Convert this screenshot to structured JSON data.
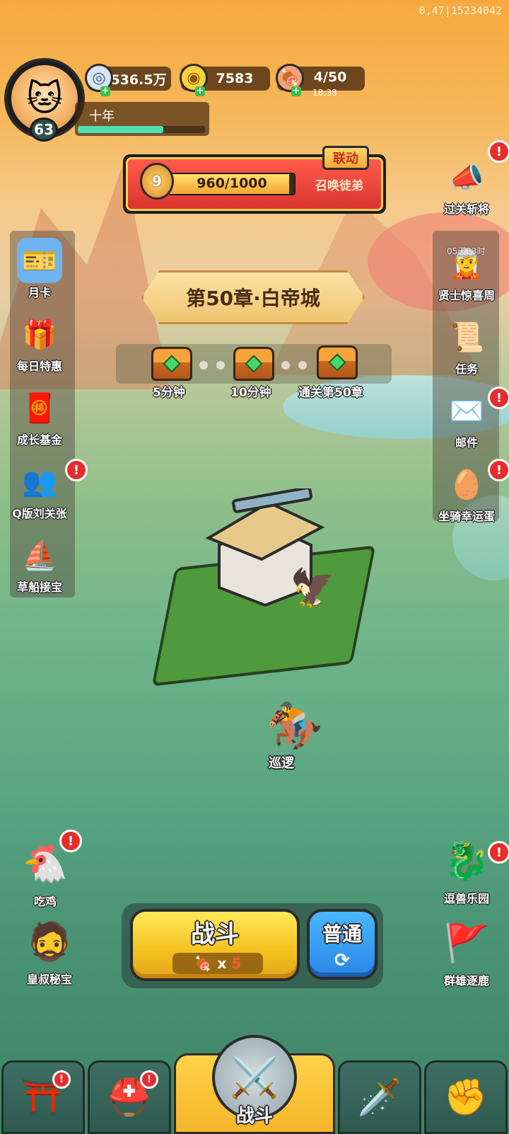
{
  "debug_overlay": "0,47|15234042",
  "player": {
    "level": "63",
    "name": "十年",
    "exp_fraction": 0.67
  },
  "resources": [
    {
      "icon": "silver-coin-icon",
      "value": "536.5万"
    },
    {
      "icon": "gold-ingot-icon",
      "value": "7583"
    },
    {
      "icon": "meat-icon",
      "value": "4/50",
      "timer": "18:38"
    }
  ],
  "banner": {
    "tag": "联动",
    "medal_level": "9",
    "progress_text": "960/1000",
    "progress_fraction": 0.96,
    "action_label": "召唤徒弟"
  },
  "chapter": {
    "title": "第50章·白帝城"
  },
  "rewards": [
    {
      "label": "5分钟"
    },
    {
      "label": "10分钟"
    },
    {
      "label": "通关第50章"
    }
  ],
  "left_menu": [
    {
      "id": "monthly-card",
      "label": "月卡",
      "icon": "welfare-card-icon",
      "alert": false
    },
    {
      "id": "daily-deal",
      "label": "每日特惠",
      "icon": "gift-bag-icon",
      "alert": false
    },
    {
      "id": "growth-fund",
      "label": "成长基金",
      "icon": "money-god-icon",
      "alert": false
    },
    {
      "id": "q-liu-guan-zhang",
      "label": "Q版刘关张",
      "icon": "three-brothers-icon",
      "alert": true
    },
    {
      "id": "straw-boat",
      "label": "草船接宝",
      "icon": "boat-icon",
      "alert": false
    }
  ],
  "right_menu": [
    {
      "id": "stage-general",
      "label": "过关斩将",
      "icon": "megaphone-girl-icon",
      "alert": true
    },
    {
      "id": "sage-week",
      "label": "贤士惊喜周",
      "icon": "sage-icon",
      "alert": false,
      "timer": "05天23时"
    },
    {
      "id": "tasks",
      "label": "任务",
      "icon": "scroll-icon",
      "alert": false
    },
    {
      "id": "mail",
      "label": "邮件",
      "icon": "mail-icon",
      "alert": true
    },
    {
      "id": "mount-egg",
      "label": "坐骑幸运蛋",
      "icon": "panda-egg-icon",
      "alert": true
    }
  ],
  "bottom_left": [
    {
      "id": "chicken",
      "label": "吃鸡",
      "icon": "chicken-warrior-icon",
      "alert": true
    },
    {
      "id": "uncle-treasure",
      "label": "皇叔秘宝",
      "icon": "emperor-uncle-icon",
      "alert": false
    }
  ],
  "bottom_right": [
    {
      "id": "beast-park",
      "label": "逗兽乐园",
      "icon": "purple-beast-icon",
      "alert": true
    },
    {
      "id": "heroes-chase",
      "label": "群雄逐鹿",
      "icon": "battle-banner-icon",
      "alert": false
    }
  ],
  "scene": {
    "patrol_label": "巡逻"
  },
  "battle": {
    "fight_label": "战斗",
    "cost_prefix": "x",
    "cost_value": "5",
    "mode_label": "普通"
  },
  "bottom_nav": [
    {
      "id": "city",
      "icon": "gate-icon",
      "alert": true
    },
    {
      "id": "heroes",
      "icon": "helmet-icon",
      "alert": true
    },
    {
      "id": "battle",
      "label": "战斗",
      "icon": "crossed-swords-icon",
      "alert": false
    },
    {
      "id": "equipment",
      "icon": "weapon-stars-icon",
      "alert": false
    },
    {
      "id": "upgrade",
      "icon": "power-fist-icon",
      "alert": false
    }
  ]
}
